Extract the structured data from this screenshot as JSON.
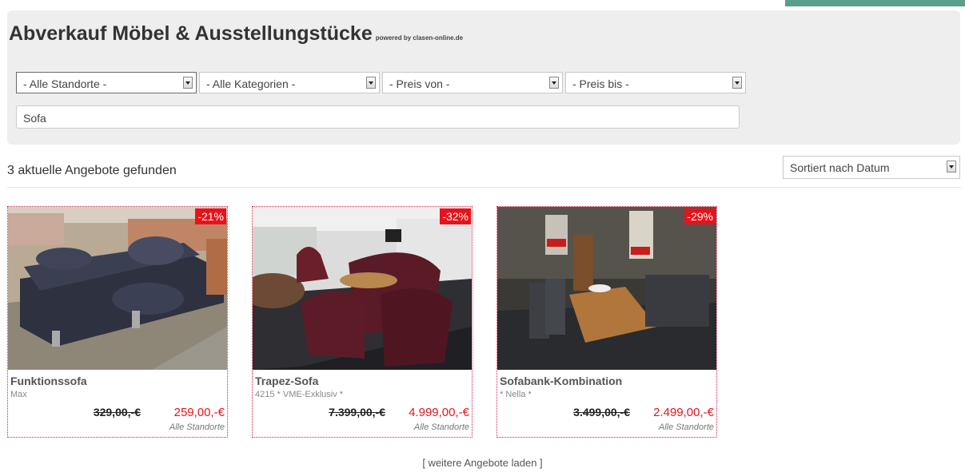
{
  "header": {
    "title": "Abverkauf Möbel & Ausstellungstücke",
    "powered_by": "powered by clasen-online.de"
  },
  "filters": {
    "location": "- Alle Standorte -",
    "category": "- Alle Kategorien -",
    "price_from": "- Preis von -",
    "price_to": "- Preis bis -",
    "search_value": "Sofa"
  },
  "results": {
    "count_text": "3 aktuelle Angebote gefunden",
    "sort_value": "Sortiert nach Datum"
  },
  "products": [
    {
      "discount": "-21%",
      "name": "Funktionssofa",
      "subtitle": "Max",
      "old_price": "329,00,-€",
      "new_price": "259,00,-€",
      "location": "Alle Standorte"
    },
    {
      "discount": "-32%",
      "name": "Trapez-Sofa",
      "subtitle": "4215 * VME-Exklusiv *",
      "old_price": "7.399,00,-€",
      "new_price": "4.999,00,-€",
      "location": "Alle Standorte"
    },
    {
      "discount": "-29%",
      "name": "Sofabank-Kombination",
      "subtitle": "* Nella *",
      "old_price": "3.499,00,-€",
      "new_price": "2.499,00,-€",
      "location": "Alle Standorte"
    }
  ],
  "load_more": "[ weitere Angebote laden ]",
  "colors": {
    "accent": "#5a9e8c",
    "sale_red": "#e8131a",
    "panel_bg": "#eeeeee"
  }
}
